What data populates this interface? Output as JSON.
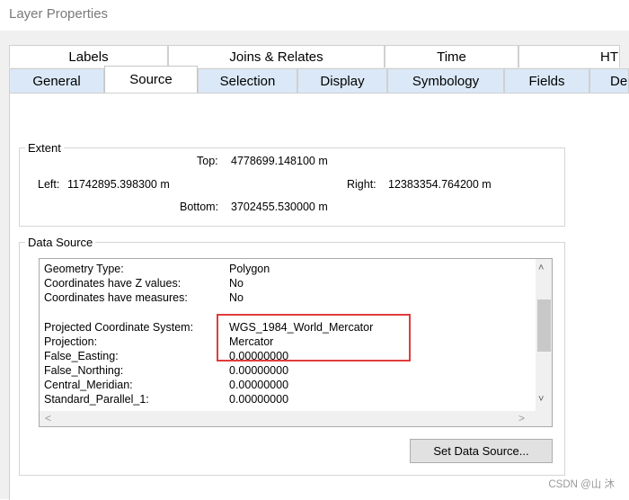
{
  "window": {
    "title": "Layer Properties"
  },
  "tabs_row1": [
    {
      "label": "Labels"
    },
    {
      "label": "Joins & Relates"
    },
    {
      "label": "Time"
    },
    {
      "label": "HTM"
    }
  ],
  "tabs_row2": [
    {
      "label": "General"
    },
    {
      "label": "Source"
    },
    {
      "label": "Selection"
    },
    {
      "label": "Display"
    },
    {
      "label": "Symbology"
    },
    {
      "label": "Fields"
    },
    {
      "label": "De"
    }
  ],
  "extent": {
    "legend": "Extent",
    "top_label": "Top:",
    "top_value": "4778699.148100 m",
    "left_label": "Left:",
    "left_value": "11742895.398300 m",
    "right_label": "Right:",
    "right_value": "12383354.764200 m",
    "bottom_label": "Bottom:",
    "bottom_value": "3702455.530000 m"
  },
  "data_source": {
    "legend": "Data Source",
    "rows": [
      {
        "name": "Geometry Type:",
        "value": "Polygon"
      },
      {
        "name": "Coordinates have Z values:",
        "value": "No"
      },
      {
        "name": "Coordinates have measures:",
        "value": "No"
      },
      {
        "name": "",
        "value": ""
      },
      {
        "name": "Projected Coordinate System:",
        "value": "WGS_1984_World_Mercator"
      },
      {
        "name": "Projection:",
        "value": "Mercator"
      },
      {
        "name": "False_Easting:",
        "value": "0.00000000"
      },
      {
        "name": "False_Northing:",
        "value": "0.00000000"
      },
      {
        "name": "Central_Meridian:",
        "value": "0.00000000"
      },
      {
        "name": "Standard_Parallel_1:",
        "value": "0.00000000"
      }
    ],
    "set_button": "Set Data Source..."
  },
  "watermark": "CSDN @山 沐",
  "colors": {
    "highlight": "#e03c3c",
    "inactive_tab": "#dbe8f7"
  }
}
